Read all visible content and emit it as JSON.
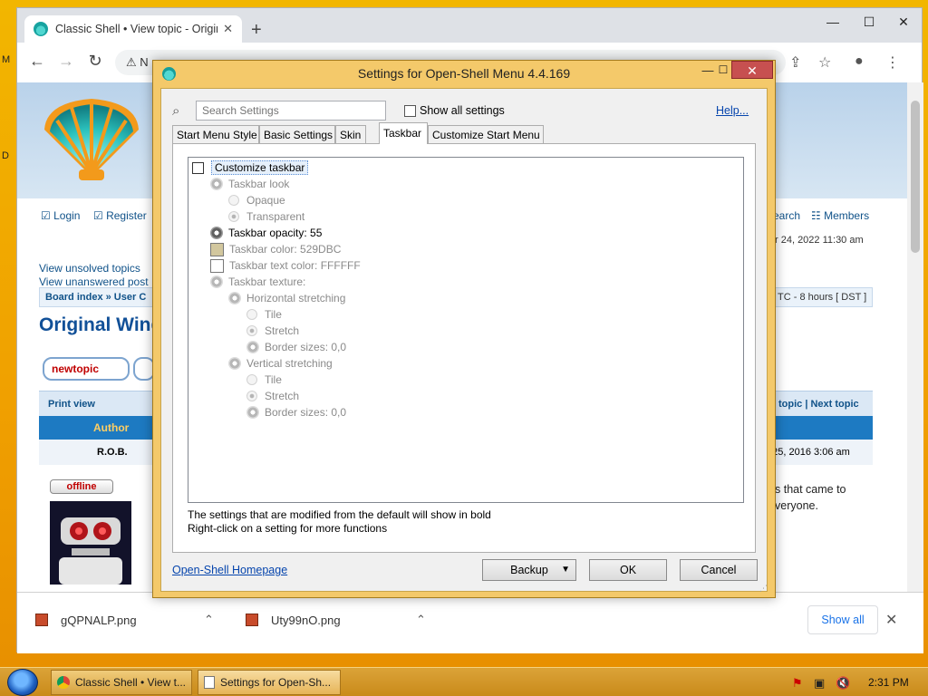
{
  "desktop": {
    "edge_texts": [
      "M",
      "D"
    ]
  },
  "browser": {
    "tab_title": "Classic Shell • View topic - Origin",
    "new_tab": "+",
    "controls": {
      "minimize": "—",
      "maximize": "☐",
      "close": "✕"
    },
    "omnibox_text": "N",
    "page": {
      "login": "Login",
      "register": "Register",
      "search": "earch",
      "members": "Members",
      "date_now": "r 24, 2022 11:30 am",
      "unsolved": "View unsolved topics",
      "unanswered": "View unanswered post",
      "breadcrumb": "Board index » User C",
      "timezone": "TC - 8 hours [ DST ]",
      "topic_title": "Original Wind",
      "new_topic": "newtopic",
      "print_view": "Print view",
      "nav_topics": "topic | Next topic",
      "author_header": "Author",
      "post_author": "R.O.B.",
      "post_date": "g 25, 2016 3:06 am",
      "offline": "offline",
      "post_line1": "s that came to",
      "post_line2": "veryone."
    },
    "downloads": [
      {
        "name": "gQPNALP.png"
      },
      {
        "name": "Uty99nO.png"
      }
    ],
    "show_all": "Show all"
  },
  "dialog": {
    "title": "Settings for Open-Shell Menu 4.4.169",
    "search_placeholder": "Search Settings",
    "show_all_settings": "Show all settings",
    "help": "Help...",
    "tabs": [
      "Start Menu Style",
      "Basic Settings",
      "Skin",
      "Taskbar",
      "Customize Start Menu"
    ],
    "active_tab": "Taskbar",
    "tree": {
      "customize_taskbar": "Customize taskbar",
      "taskbar_look": "Taskbar look",
      "opaque": "Opaque",
      "transparent": "Transparent",
      "taskbar_opacity": "Taskbar opacity: 55",
      "taskbar_color": "Taskbar color: 529DBC",
      "taskbar_text_color": "Taskbar text color: FFFFFF",
      "taskbar_texture": "Taskbar texture:",
      "horizontal_stretching": "Horizontal stretching",
      "h_tile": "Tile",
      "h_stretch": "Stretch",
      "h_border": "Border sizes: 0,0",
      "vertical_stretching": "Vertical stretching",
      "v_tile": "Tile",
      "v_stretch": "Stretch",
      "v_border": "Border sizes: 0,0"
    },
    "hint1": "The settings that are modified from the default will show in bold",
    "hint2": "Right-click on a setting for more functions",
    "homepage": "Open-Shell Homepage",
    "backup": "Backup",
    "ok": "OK",
    "cancel": "Cancel",
    "colors": {
      "taskbar_swatch": "#d2c79e",
      "text_swatch": "#ffffff"
    }
  },
  "taskbar": {
    "items": [
      "Classic Shell • View t...",
      "Settings for Open-Sh..."
    ],
    "clock": "2:31 PM"
  }
}
